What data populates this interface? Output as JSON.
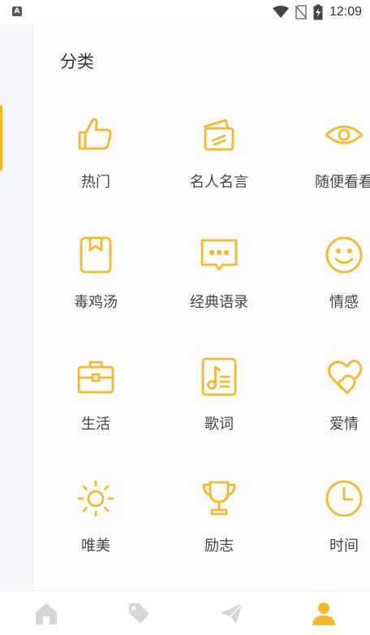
{
  "status_bar": {
    "app_badge": "A",
    "time": "12:09"
  },
  "header": {
    "title": "分类"
  },
  "categories": [
    {
      "label": "热门",
      "icon": "thumbs-up-icon"
    },
    {
      "label": "名人名言",
      "icon": "cards-icon"
    },
    {
      "label": "随便看看",
      "icon": "eye-icon"
    },
    {
      "label": "毒鸡汤",
      "icon": "book-bookmark-icon"
    },
    {
      "label": "经典语录",
      "icon": "chat-bubble-icon"
    },
    {
      "label": "情感",
      "icon": "smile-icon"
    },
    {
      "label": "生活",
      "icon": "briefcase-icon"
    },
    {
      "label": "歌词",
      "icon": "music-note-icon"
    },
    {
      "label": "爱情",
      "icon": "hearts-icon"
    },
    {
      "label": "唯美",
      "icon": "sun-icon"
    },
    {
      "label": "励志",
      "icon": "trophy-icon"
    },
    {
      "label": "时间",
      "icon": "clock-icon"
    }
  ],
  "tabbar": {
    "items": [
      {
        "label": "",
        "icon": "home-icon"
      },
      {
        "label": "",
        "icon": "tag-icon"
      },
      {
        "label": "",
        "icon": "send-icon"
      },
      {
        "label": "",
        "icon": "user-icon",
        "active": true
      }
    ]
  },
  "colors": {
    "accent": "#f7b925",
    "inactive": "#d6d6d6"
  }
}
